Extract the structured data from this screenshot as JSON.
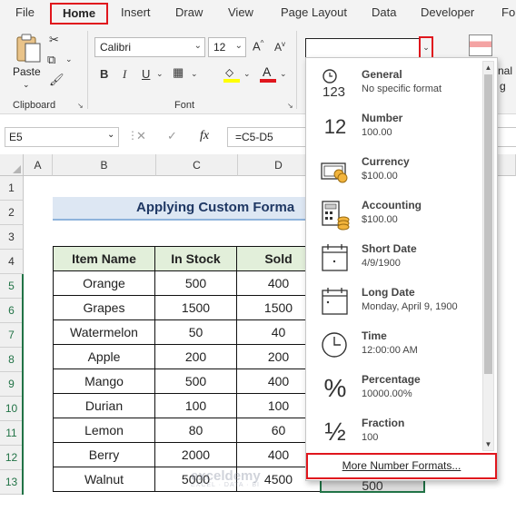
{
  "menu": {
    "items": [
      "File",
      "Home",
      "Insert",
      "Draw",
      "View",
      "Page Layout",
      "Data",
      "Developer",
      "Fo"
    ]
  },
  "ribbon": {
    "paste_label": "Paste",
    "clipboard_label": "Clipboard",
    "font_label": "Font",
    "font_name": "Calibri",
    "font_size": "12",
    "right_partial": "nal",
    "right_partial2": "g"
  },
  "formula_bar": {
    "name_box": "E5",
    "formula": "=C5-D5"
  },
  "grid": {
    "columns": [
      "A",
      "B",
      "C",
      "D"
    ],
    "rows": [
      "1",
      "2",
      "3",
      "4",
      "5",
      "6",
      "7",
      "8",
      "9",
      "10",
      "11",
      "12",
      "13"
    ],
    "title": "Applying Custom Forma",
    "headers": [
      "Item Name",
      "In Stock",
      "Sold"
    ],
    "data": [
      [
        "Orange",
        "500",
        "400"
      ],
      [
        "Grapes",
        "1500",
        "1500"
      ],
      [
        "Watermelon",
        "50",
        "40"
      ],
      [
        "Apple",
        "200",
        "200"
      ],
      [
        "Mango",
        "500",
        "400"
      ],
      [
        "Durian",
        "100",
        "100"
      ],
      [
        "Lemon",
        "80",
        "60"
      ],
      [
        "Berry",
        "2000",
        "400"
      ],
      [
        "Walnut",
        "5000",
        "4500"
      ]
    ],
    "e13_partial": "500"
  },
  "number_format_dropdown": {
    "items": [
      {
        "name": "General",
        "sample": "No specific format",
        "icon": "general-123-icon",
        "glyph": "123"
      },
      {
        "name": "Number",
        "sample": "100.00",
        "icon": "number-12-icon",
        "glyph": "12"
      },
      {
        "name": "Currency",
        "sample": "$100.00",
        "icon": "currency-icon",
        "glyph": ""
      },
      {
        "name": "Accounting",
        "sample": "$100.00",
        "icon": "accounting-icon",
        "glyph": ""
      },
      {
        "name": "Short Date",
        "sample": "4/9/1900",
        "icon": "calendar-icon",
        "glyph": ""
      },
      {
        "name": "Long Date",
        "sample": "Monday, April 9, 1900",
        "icon": "calendar-icon",
        "glyph": ""
      },
      {
        "name": "Time",
        "sample": "12:00:00 AM",
        "icon": "clock-icon",
        "glyph": ""
      },
      {
        "name": "Percentage",
        "sample": "10000.00%",
        "icon": "percent-icon",
        "glyph": "%"
      },
      {
        "name": "Fraction",
        "sample": "100",
        "icon": "fraction-icon",
        "glyph": "½"
      }
    ],
    "more_label": "More Number Formats..."
  },
  "watermark": {
    "main": "exceldemy",
    "sub": "EXCEL · DATA · BI"
  },
  "colors": {
    "accent": "#217346",
    "highlight": "#e0161d",
    "header_fill": "#e2efda",
    "title_fill": "#dde7f3"
  }
}
